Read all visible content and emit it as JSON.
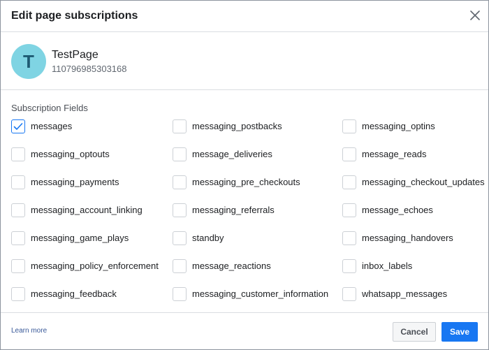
{
  "dialog": {
    "title": "Edit page subscriptions"
  },
  "page": {
    "avatar_letter": "T",
    "name": "TestPage",
    "id": "110796985303168"
  },
  "subscriptions": {
    "label": "Subscription Fields",
    "fields": [
      {
        "label": "messages",
        "checked": true
      },
      {
        "label": "messaging_postbacks",
        "checked": false
      },
      {
        "label": "messaging_optins",
        "checked": false
      },
      {
        "label": "messaging_optouts",
        "checked": false
      },
      {
        "label": "message_deliveries",
        "checked": false
      },
      {
        "label": "message_reads",
        "checked": false
      },
      {
        "label": "messaging_payments",
        "checked": false
      },
      {
        "label": "messaging_pre_checkouts",
        "checked": false
      },
      {
        "label": "messaging_checkout_updates",
        "checked": false
      },
      {
        "label": "messaging_account_linking",
        "checked": false
      },
      {
        "label": "messaging_referrals",
        "checked": false
      },
      {
        "label": "message_echoes",
        "checked": false
      },
      {
        "label": "messaging_game_plays",
        "checked": false
      },
      {
        "label": "standby",
        "checked": false
      },
      {
        "label": "messaging_handovers",
        "checked": false
      },
      {
        "label": "messaging_policy_enforcement",
        "checked": false
      },
      {
        "label": "message_reactions",
        "checked": false
      },
      {
        "label": "inbox_labels",
        "checked": false
      },
      {
        "label": "messaging_feedback",
        "checked": false
      },
      {
        "label": "messaging_customer_information",
        "checked": false
      },
      {
        "label": "whatsapp_messages",
        "checked": false
      }
    ]
  },
  "footer": {
    "learn_more": "Learn more",
    "cancel_label": "Cancel",
    "save_label": "Save"
  },
  "colors": {
    "accent": "#1877f2",
    "avatar_bg": "#7fd4e3",
    "link": "#385898"
  },
  "icons": {
    "close": "close-icon",
    "check": "checkmark-icon"
  }
}
